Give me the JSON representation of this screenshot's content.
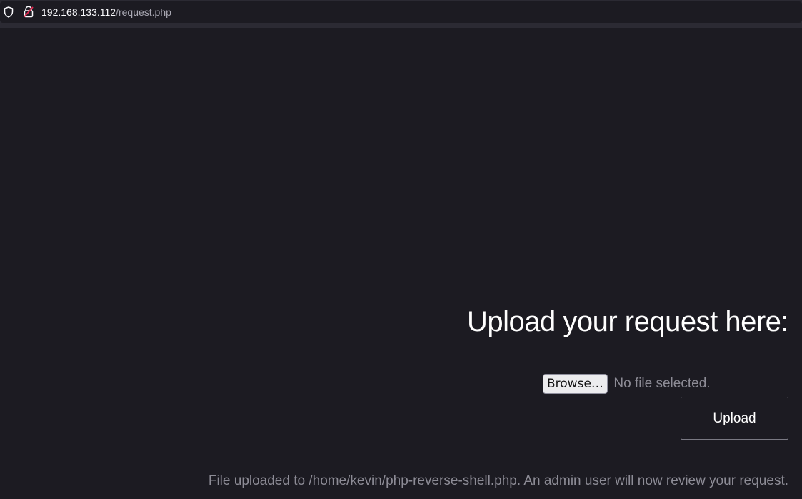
{
  "browser": {
    "url_host": "192.168.133.112",
    "url_path": "/request.php",
    "icons": [
      "shield-icon",
      "lock-warning-icon"
    ]
  },
  "page": {
    "heading": "Upload your request here:",
    "browse_label": "Browse…",
    "file_status": "No file selected.",
    "upload_label": "Upload",
    "status_message": "File uploaded to /home/kevin/php-reverse-shell.php. An admin user will now review your request."
  },
  "colors": {
    "background": "#1c1b22",
    "text": "#ffffff",
    "muted_text": "#8d8c96",
    "warning_accent": "#e22850"
  }
}
